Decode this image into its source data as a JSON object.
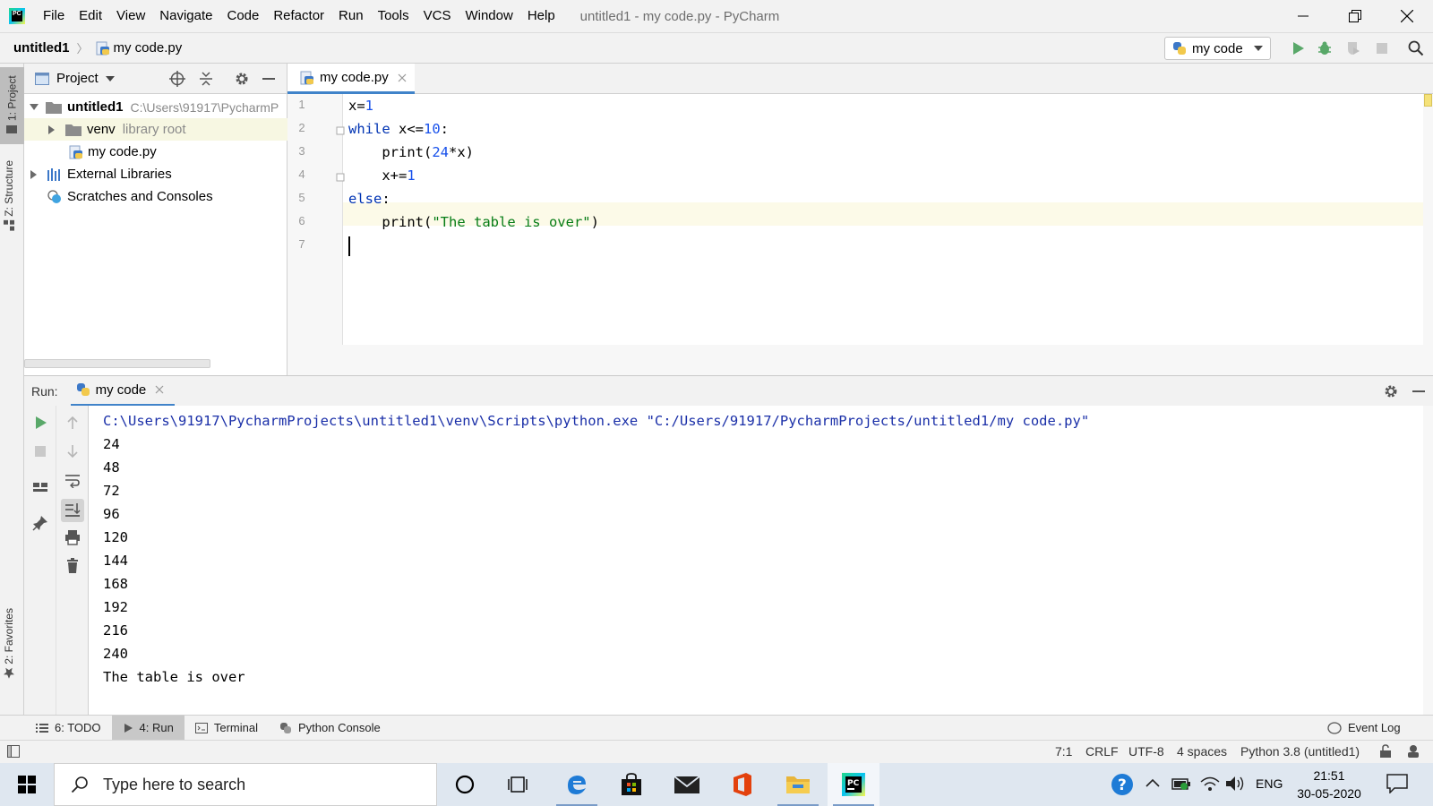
{
  "app": {
    "logo_text": "PC",
    "window_title": "untitled1 - my code.py - PyCharm"
  },
  "menu": [
    "File",
    "Edit",
    "View",
    "Navigate",
    "Code",
    "Refactor",
    "Run",
    "Tools",
    "VCS",
    "Window",
    "Help"
  ],
  "navbar": {
    "project": "untitled1",
    "file": "my code.py",
    "run_config": "my code"
  },
  "left_strip": {
    "project_tab": "1: Project",
    "structure_tab": "Z: Structure",
    "favorites_tab": "2: Favorites"
  },
  "project_panel": {
    "title": "Project",
    "tree": [
      {
        "name": "untitled1",
        "extra": "C:\\Users\\91917\\PycharmP"
      },
      {
        "name": "venv",
        "extra": "library root"
      },
      {
        "name": "my code.py",
        "extra": ""
      },
      {
        "name": "External Libraries",
        "extra": ""
      },
      {
        "name": "Scratches and Consoles",
        "extra": ""
      }
    ]
  },
  "editor": {
    "tab": "my code.py",
    "line_numbers": [
      "1",
      "2",
      "3",
      "4",
      "5",
      "6",
      "7"
    ],
    "code": {
      "l1_a": "x=",
      "l1_b": "1",
      "l2_kw": "while",
      "l2_a": " x<=",
      "l2_b": "10",
      "l2_c": ":",
      "l3_a": "    print(",
      "l3_b": "24",
      "l3_c": "*x)",
      "l4_a": "    x+=",
      "l4_b": "1",
      "l5_kw": "else",
      "l5_a": ":",
      "l6_a": "    print(",
      "l6_b": "\"The table is over\"",
      "l6_c": ")"
    }
  },
  "run_panel": {
    "label": "Run:",
    "tab": "my code",
    "output": [
      "C:\\Users\\91917\\PycharmProjects\\untitled1\\venv\\Scripts\\python.exe \"C:/Users/91917/PycharmProjects/untitled1/my code.py\"",
      "24",
      "48",
      "72",
      "96",
      "120",
      "144",
      "168",
      "192",
      "216",
      "240",
      "The table is over"
    ]
  },
  "bottom_tabs": {
    "todo": "6: TODO",
    "run": "4: Run",
    "terminal": "Terminal",
    "python_console": "Python Console",
    "event_log": "Event Log"
  },
  "statusbar": {
    "position": "7:1",
    "line_sep": "CRLF",
    "encoding": "UTF-8",
    "indent": "4 spaces",
    "interpreter": "Python 3.8 (untitled1)"
  },
  "taskbar": {
    "search_placeholder": "Type here to search",
    "lang": "ENG",
    "time": "21:51",
    "date": "30-05-2020"
  },
  "colors": {
    "accent": "#4083c9",
    "keyword": "#0033b3",
    "number": "#1750eb",
    "string": "#067d17",
    "run_green": "#59a869"
  }
}
